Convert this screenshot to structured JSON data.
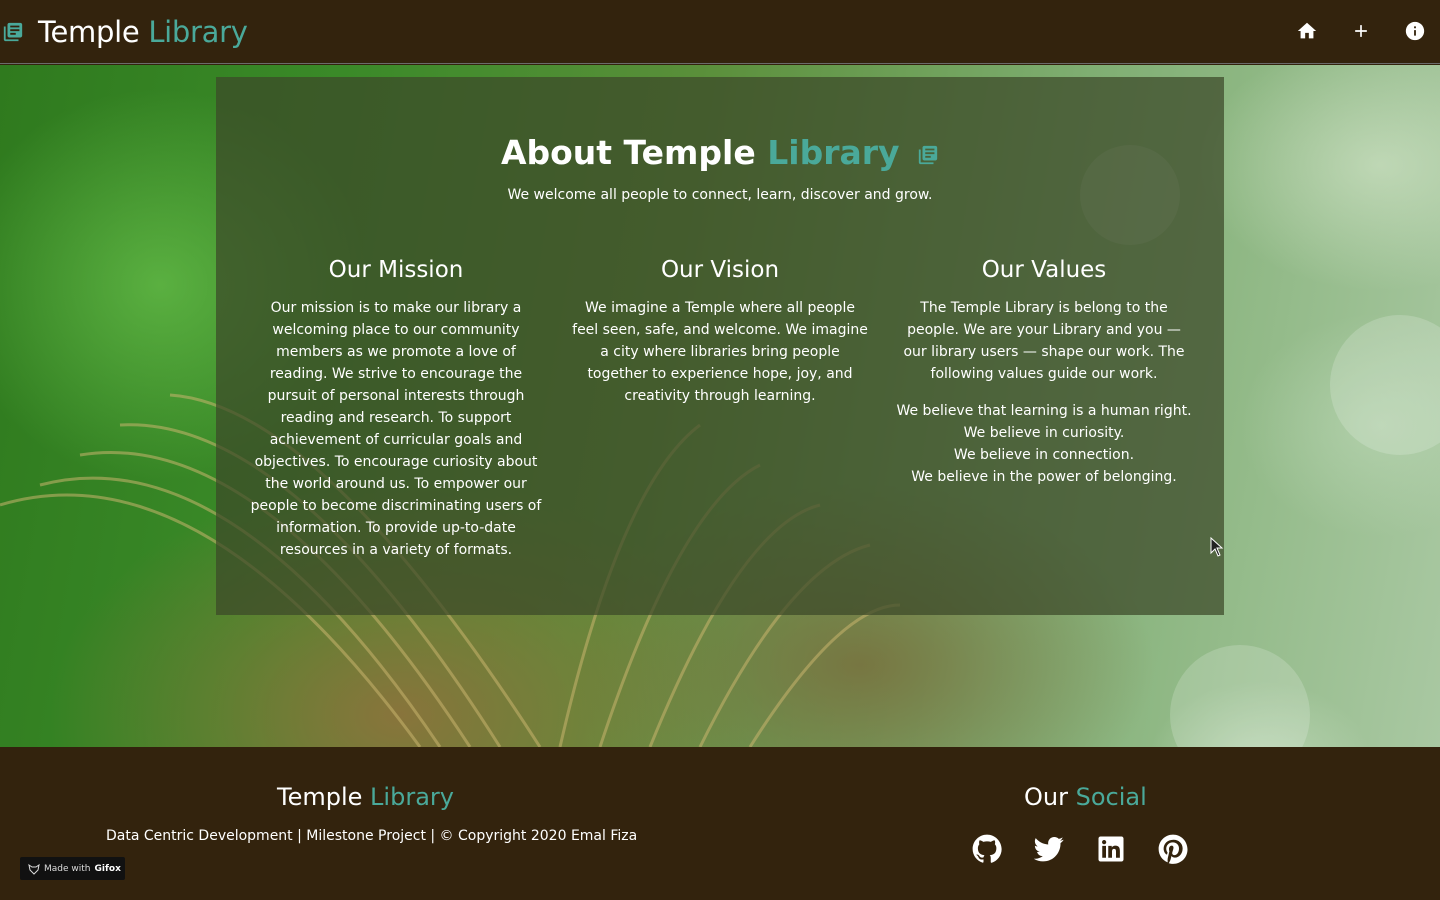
{
  "header": {
    "brand_main": "Temple",
    "brand_accent": "Library",
    "nav": [
      {
        "icon": "home-icon"
      },
      {
        "icon": "plus-icon"
      },
      {
        "icon": "info-icon"
      }
    ]
  },
  "about": {
    "title_main": "About Temple",
    "title_accent": "Library",
    "subtitle": "We welcome all people to connect, learn, discover and grow.",
    "mission": {
      "heading": "Our Mission",
      "text": "Our mission is to make our library a welcoming place to our community members as we promote a love of reading. We strive to encourage the pursuit of personal interests through reading and research. To support achievement of curricular goals and objectives. To encourage curiosity about the world around us. To empower our people to become discriminating users of information. To provide up-to-date resources in a variety of formats."
    },
    "vision": {
      "heading": "Our Vision",
      "text": "We imagine a Temple where all people feel seen, safe, and welcome. We imagine a city where libraries bring people together to experience hope, joy, and creativity through learning."
    },
    "values": {
      "heading": "Our Values",
      "intro": "The Temple Library is belong to the people. We are your Library and you — our library users — shape our work. The following values guide our work.",
      "beliefs": [
        "We believe that learning is a human right.",
        "We believe in curiosity.",
        "We believe in connection.",
        "We believe in the power of belonging."
      ]
    }
  },
  "footer": {
    "brand_main": "Temple",
    "brand_accent": "Library",
    "copyright": "Data Centric Development | Milestone Project | © Copyright 2020 Emal Fiza",
    "social_main": "Our",
    "social_accent": "Social",
    "social": [
      "github-icon",
      "twitter-icon",
      "linkedin-icon",
      "pinterest-icon"
    ],
    "badge_prefix": "Made with",
    "badge_brand": "Gifox"
  },
  "colors": {
    "background": "#33230d",
    "accent": "#4aa99a"
  }
}
